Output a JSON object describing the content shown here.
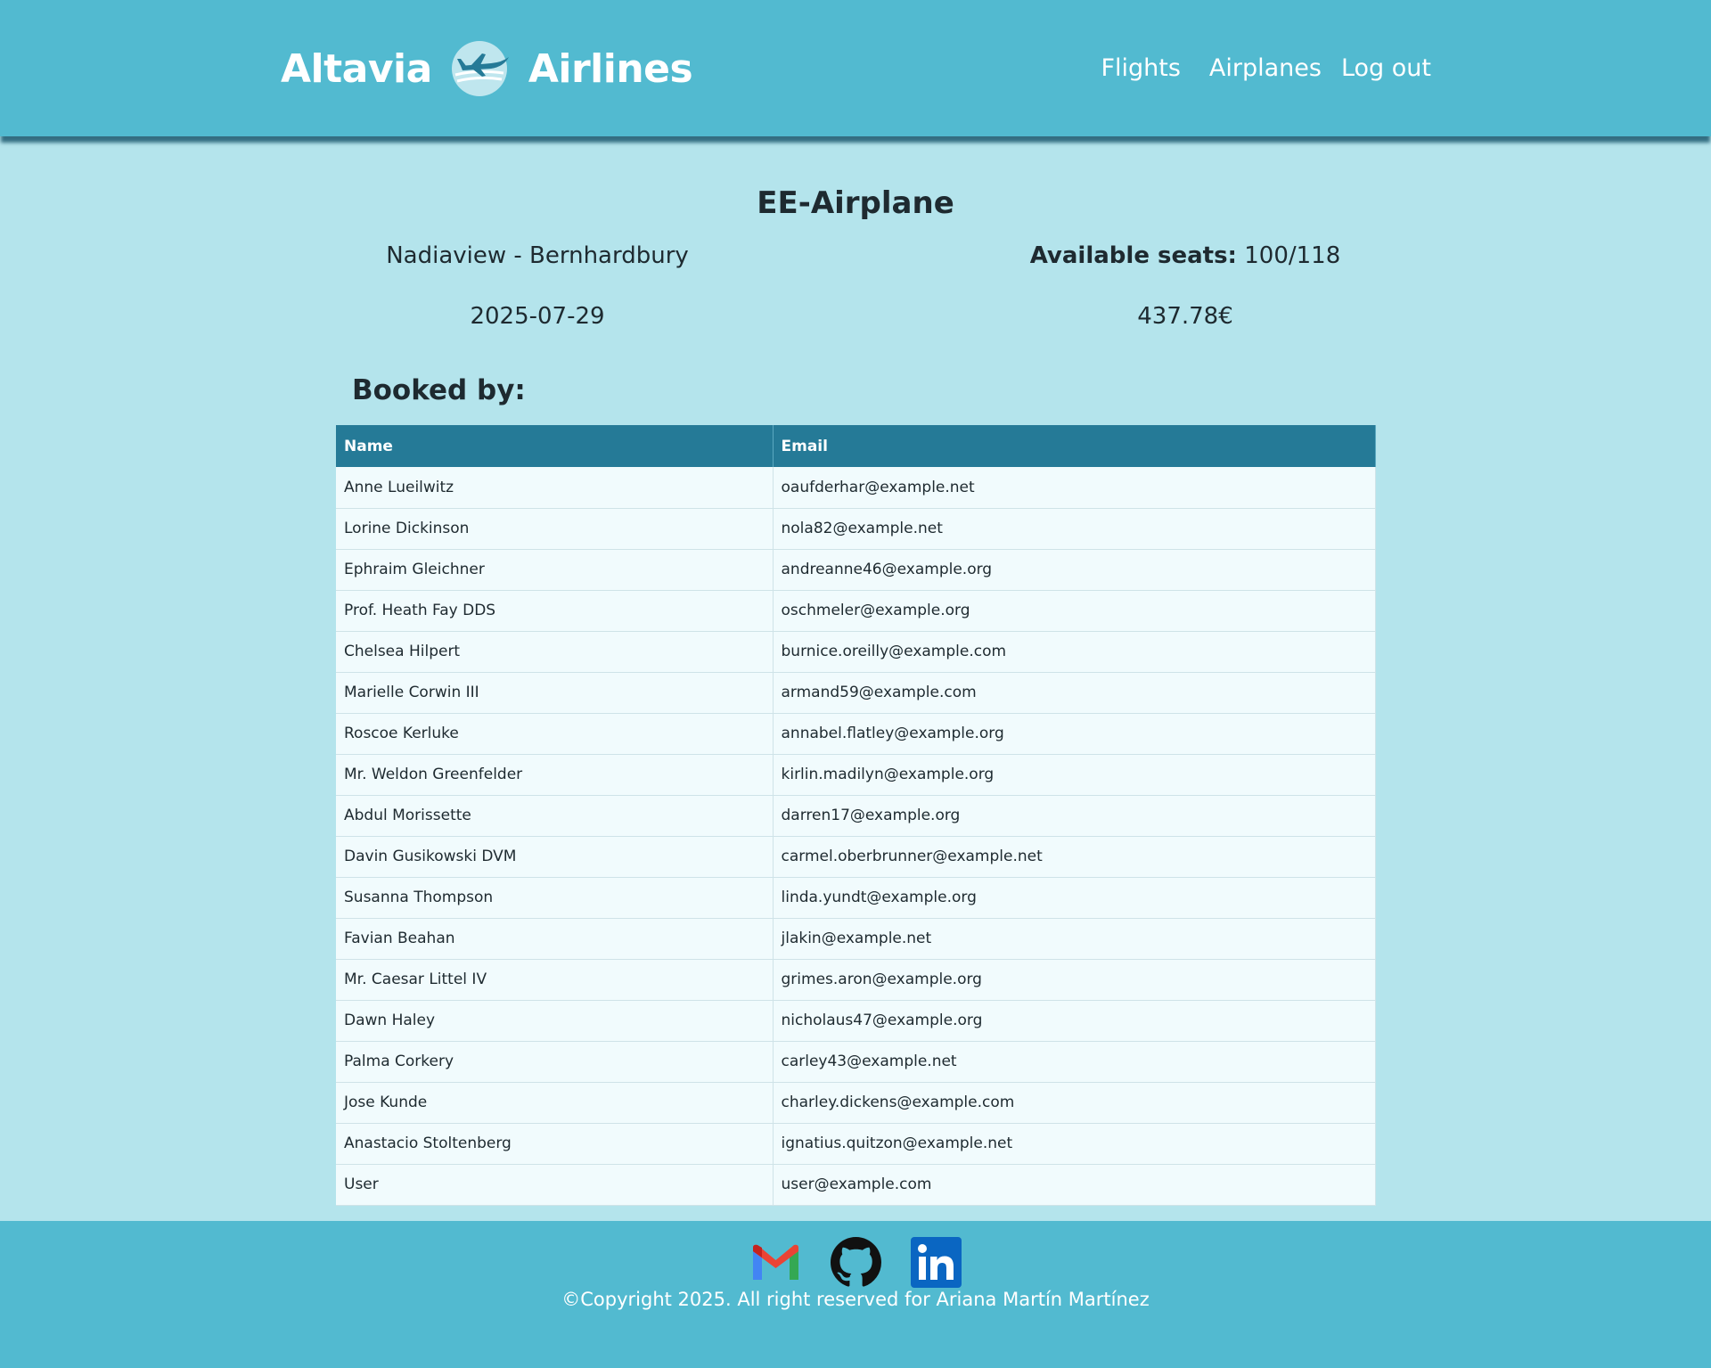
{
  "header": {
    "brand_left": "Altavia",
    "brand_right": "Airlines",
    "logo_icon": "airplane-logo-icon",
    "nav": [
      "Flights",
      "Airplanes",
      "Log out"
    ]
  },
  "flight": {
    "airplane": "EE-Airplane",
    "route": "Nadiaview - Bernhardbury",
    "date": "2025-07-29",
    "seats_label": "Available seats:",
    "seats_value": "100/118",
    "price": "437.78€"
  },
  "bookings": {
    "title": "Booked by:",
    "columns": [
      "Name",
      "Email"
    ],
    "rows": [
      [
        "Anne Lueilwitz",
        "oaufderhar@example.net"
      ],
      [
        "Lorine Dickinson",
        "nola82@example.net"
      ],
      [
        "Ephraim Gleichner",
        "andreanne46@example.org"
      ],
      [
        "Prof. Heath Fay DDS",
        "oschmeler@example.org"
      ],
      [
        "Chelsea Hilpert",
        "burnice.oreilly@example.com"
      ],
      [
        "Marielle Corwin III",
        "armand59@example.com"
      ],
      [
        "Roscoe Kerluke",
        "annabel.flatley@example.org"
      ],
      [
        "Mr. Weldon Greenfelder",
        "kirlin.madilyn@example.org"
      ],
      [
        "Abdul Morissette",
        "darren17@example.org"
      ],
      [
        "Davin Gusikowski DVM",
        "carmel.oberbrunner@example.net"
      ],
      [
        "Susanna Thompson",
        "linda.yundt@example.org"
      ],
      [
        "Favian Beahan",
        "jlakin@example.net"
      ],
      [
        "Mr. Caesar Littel IV",
        "grimes.aron@example.org"
      ],
      [
        "Dawn Haley",
        "nicholaus47@example.org"
      ],
      [
        "Palma Corkery",
        "carley43@example.net"
      ],
      [
        "Jose Kunde",
        "charley.dickens@example.com"
      ],
      [
        "Anastacio Stoltenberg",
        "ignatius.quitzon@example.net"
      ],
      [
        "User",
        "user@example.com"
      ]
    ]
  },
  "footer": {
    "socials": [
      "gmail-icon",
      "github-icon",
      "linkedin-icon"
    ],
    "copyright": "©Copyright 2025. All right reserved for Ariana Martín Martínez"
  },
  "colors": {
    "header_bg": "#52bad0",
    "page_bg": "#b4e4ec",
    "table_header_bg": "#257a97",
    "row_bg": "#f1fbfd"
  }
}
